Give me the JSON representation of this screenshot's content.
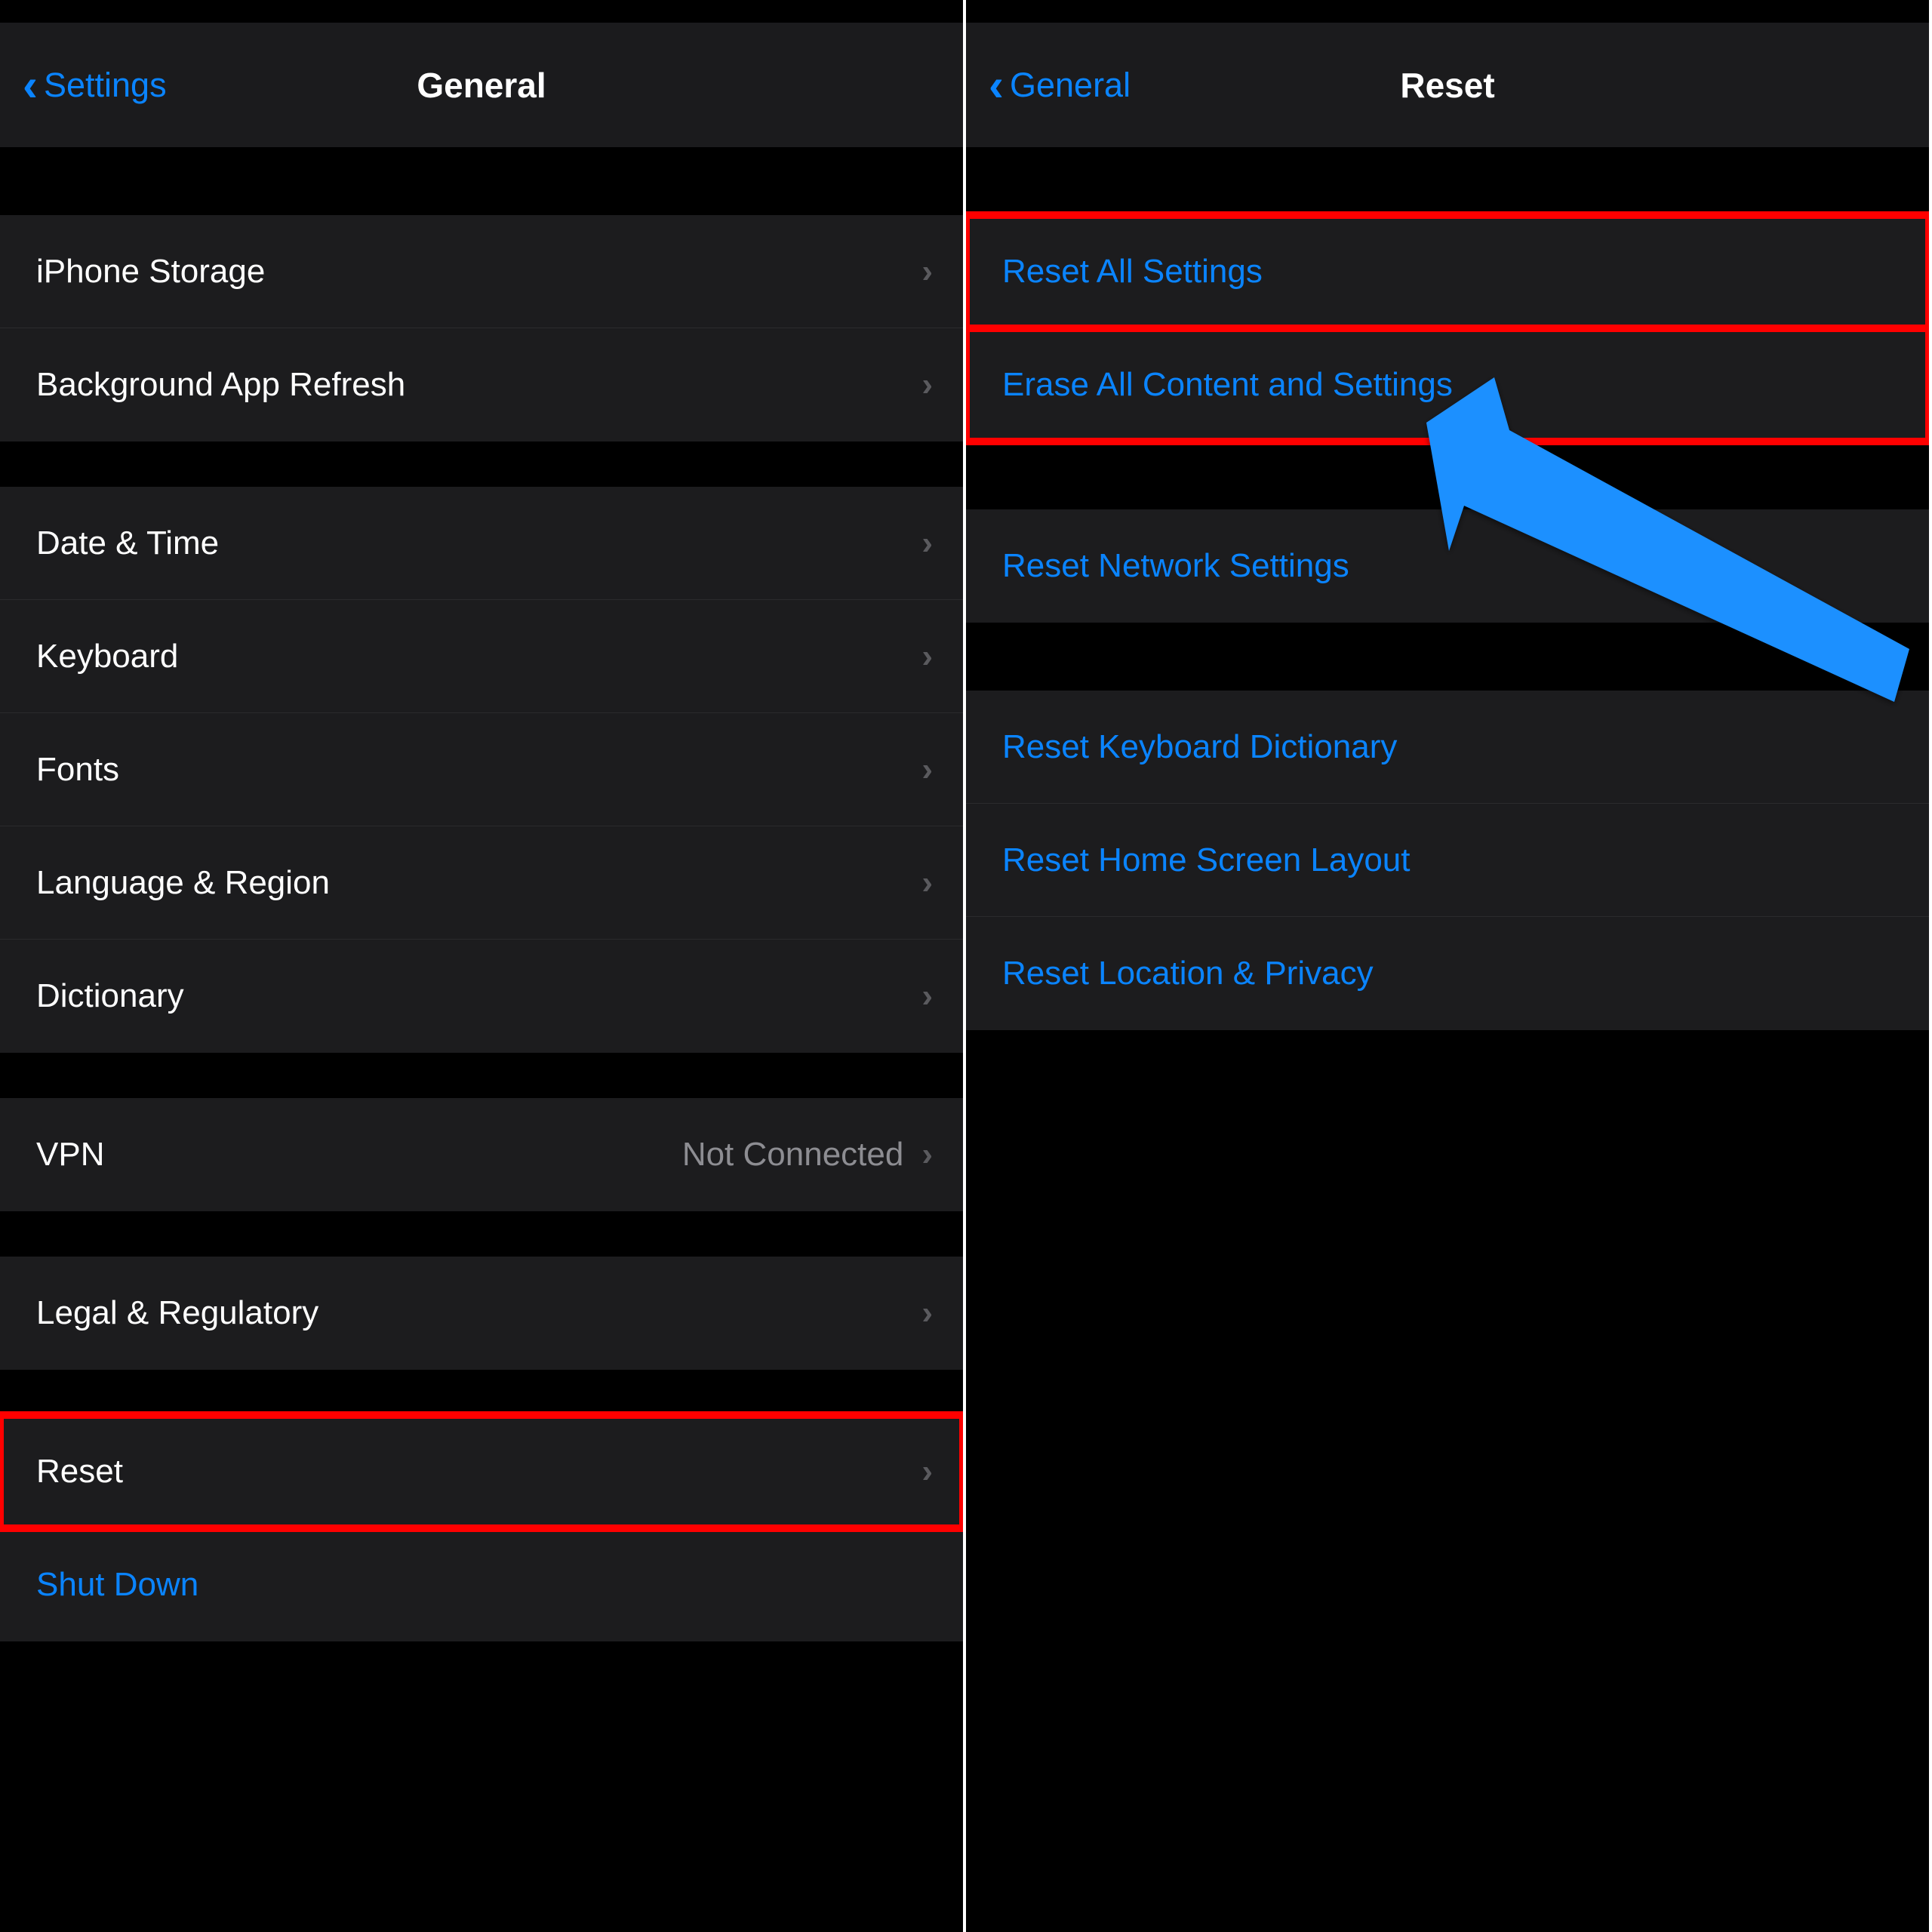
{
  "left": {
    "back_label": "Settings",
    "title": "General",
    "group1": [
      {
        "label": "iPhone Storage"
      },
      {
        "label": "Background App Refresh"
      }
    ],
    "group2": [
      {
        "label": "Date & Time"
      },
      {
        "label": "Keyboard"
      },
      {
        "label": "Fonts"
      },
      {
        "label": "Language & Region"
      },
      {
        "label": "Dictionary"
      }
    ],
    "group3_vpn_label": "VPN",
    "group3_vpn_detail": "Not Connected",
    "group4_legal": "Legal & Regulatory",
    "group5_reset": "Reset",
    "group5_shutdown": "Shut Down"
  },
  "right": {
    "back_label": "General",
    "title": "Reset",
    "group1": [
      {
        "label": "Reset All Settings"
      },
      {
        "label": "Erase All Content and Settings"
      }
    ],
    "group2_network": "Reset Network Settings",
    "group3": [
      {
        "label": "Reset Keyboard Dictionary"
      },
      {
        "label": "Reset Home Screen Layout"
      },
      {
        "label": "Reset Location & Privacy"
      }
    ]
  },
  "colors": {
    "accent": "#0a84ff",
    "highlight": "#ff0000",
    "arrow": "#1e90ff"
  }
}
